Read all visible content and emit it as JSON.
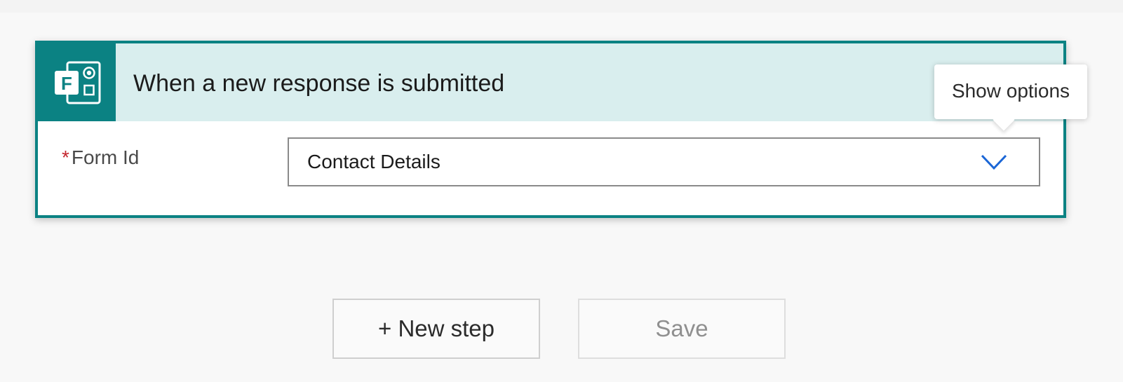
{
  "trigger_card": {
    "title": "When a new response is submitted",
    "icon": "microsoft-forms-icon",
    "field": {
      "label": "Form Id",
      "required_marker": "*",
      "value": "Contact Details"
    },
    "tooltip": "Show options"
  },
  "actions": {
    "new_step_label": "+ New step",
    "save_label": "Save"
  },
  "colors": {
    "accent": "#0b8283",
    "header_bg": "#d9eeee",
    "chevron": "#1a66d6",
    "required": "#c4262e"
  }
}
